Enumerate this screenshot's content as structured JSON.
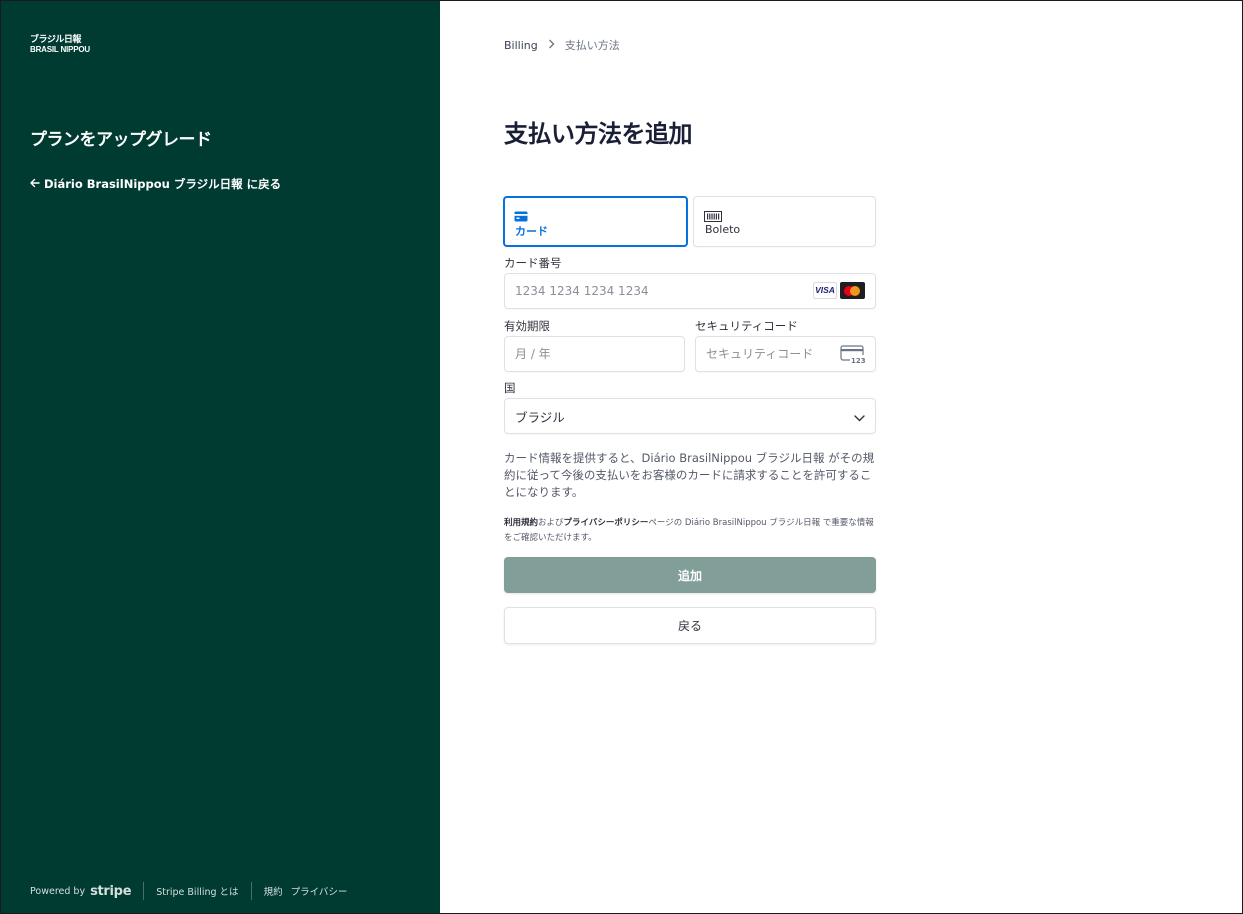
{
  "brand": {
    "logo_line1": "ブラジル日報",
    "logo_line2": "BRASIL NIPPOU"
  },
  "sidebar": {
    "title": "プランをアップグレード",
    "back_link": "Diário BrasilNippou ブラジル日報 に戻る",
    "back_icon": "arrow-left-icon"
  },
  "footer": {
    "powered_by": "Powered by",
    "stripe": "stripe",
    "stripe_billing": "Stripe Billing とは",
    "terms": "規約",
    "privacy": "プライバシー"
  },
  "breadcrumb": {
    "parent": "Billing",
    "current": "支払い方法"
  },
  "page": {
    "title": "支払い方法を追加"
  },
  "tabs": [
    {
      "label": "カード",
      "icon": "credit-card-icon",
      "selected": true
    },
    {
      "label": "Boleto",
      "icon": "barcode-icon",
      "selected": false
    }
  ],
  "form": {
    "card_number_label": "カード番号",
    "card_number_placeholder": "1234 1234 1234 1234",
    "card_brands": [
      "VISA",
      "Mastercard"
    ],
    "expiry_label": "有効期限",
    "expiry_placeholder": "月 / 年",
    "cvc_label": "セキュリティコード",
    "cvc_placeholder": "セキュリティコード",
    "cvc_icon_text": "123",
    "country_label": "国",
    "country_value": "ブラジル"
  },
  "consent": {
    "text": "カード情報を提供すると、Diário BrasilNippou ブラジル日報 がその規約に従って今後の支払いをお客様のカードに請求することを許可することになります。"
  },
  "terms": {
    "terms_link": "利用規約",
    "and": "および",
    "privacy_link": "プライバシーポリシー",
    "rest": "ページの Diário BrasilNippou ブラジル日報 で重要な情報をご確認いただけます。"
  },
  "buttons": {
    "add": "追加",
    "back": "戻る"
  },
  "colors": {
    "sidebar_bg": "#003b32",
    "accent": "#0570de",
    "primary_button": "#829e98"
  }
}
